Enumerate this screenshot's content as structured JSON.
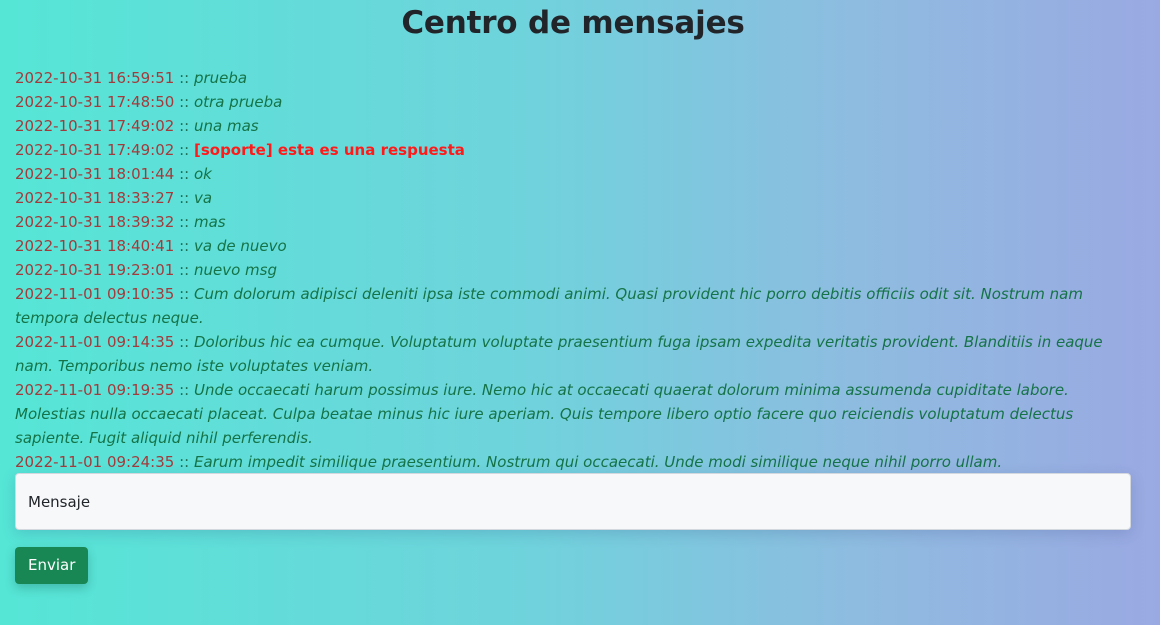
{
  "page": {
    "title": "Centro de mensajes"
  },
  "separator": "::",
  "messages": [
    {
      "timestamp": "2022-10-31 16:59:51",
      "text": "prueba",
      "support": false
    },
    {
      "timestamp": "2022-10-31 17:48:50",
      "text": "otra prueba",
      "support": false
    },
    {
      "timestamp": "2022-10-31 17:49:02",
      "text": "una mas",
      "support": false
    },
    {
      "timestamp": "2022-10-31 17:49:02",
      "text": "[soporte] esta es una respuesta",
      "support": true
    },
    {
      "timestamp": "2022-10-31 18:01:44",
      "text": "ok",
      "support": false
    },
    {
      "timestamp": "2022-10-31 18:33:27",
      "text": "va",
      "support": false
    },
    {
      "timestamp": "2022-10-31 18:39:32",
      "text": "mas",
      "support": false
    },
    {
      "timestamp": "2022-10-31 18:40:41",
      "text": "va de nuevo",
      "support": false
    },
    {
      "timestamp": "2022-10-31 19:23:01",
      "text": "nuevo msg",
      "support": false
    },
    {
      "timestamp": "2022-11-01 09:10:35",
      "text": "Cum dolorum adipisci deleniti ipsa iste commodi animi. Quasi provident hic porro debitis officiis odit sit. Nostrum nam tempora delectus neque.",
      "support": false
    },
    {
      "timestamp": "2022-11-01 09:14:35",
      "text": "Doloribus hic ea cumque. Voluptatum voluptate praesentium fuga ipsam expedita veritatis provident. Blanditiis in eaque nam. Temporibus nemo iste voluptates veniam.",
      "support": false
    },
    {
      "timestamp": "2022-11-01 09:19:35",
      "text": "Unde occaecati harum possimus iure. Nemo hic at occaecati quaerat dolorum minima assumenda cupiditate labore. Molestias nulla occaecati placeat. Culpa beatae minus hic iure aperiam. Quis tempore libero optio facere quo reiciendis voluptatum delectus sapiente. Fugit aliquid nihil perferendis.",
      "support": false
    },
    {
      "timestamp": "2022-11-01 09:24:35",
      "text": "Earum impedit similique praesentium. Nostrum qui occaecati. Unde modi similique neque nihil porro ullam.",
      "support": false
    }
  ],
  "composer": {
    "placeholder": "Mensaje",
    "value": "",
    "send_label": "Enviar"
  },
  "colors": {
    "timestamp": "#a23b3b",
    "message_text": "#157347",
    "support_text": "#ff1a1a",
    "button": "#198754"
  }
}
